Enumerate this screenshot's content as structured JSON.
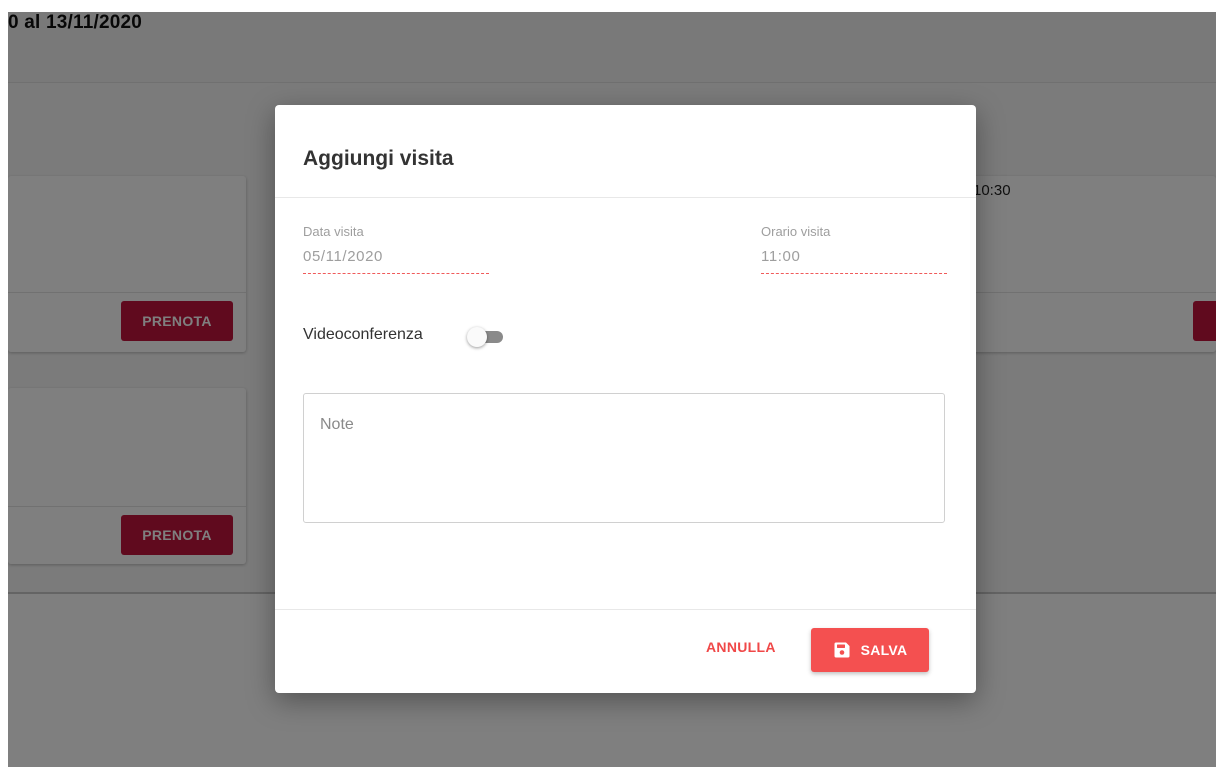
{
  "background": {
    "date_range": "0 al 13/11/2020",
    "slots": [
      {
        "button_label": "PRENOTA"
      },
      {
        "button_label": "PRENOTA"
      }
    ],
    "right_slot_time": "10:30"
  },
  "modal": {
    "title": "Aggiungi visita",
    "date_field": {
      "label": "Data visita",
      "value": "05/11/2020"
    },
    "time_field": {
      "label": "Orario visita",
      "value": "11:00"
    },
    "video_toggle": {
      "label": "Videoconferenza",
      "enabled": false
    },
    "notes": {
      "placeholder": "Note",
      "value": ""
    },
    "cancel_label": "ANNULLA",
    "save_label": "SALVA",
    "save_icon": "floppy-disk-icon"
  },
  "colors": {
    "accent": "#f45050",
    "book_button": "#c0143c",
    "overlay": "rgba(0,0,0,0.5)"
  }
}
